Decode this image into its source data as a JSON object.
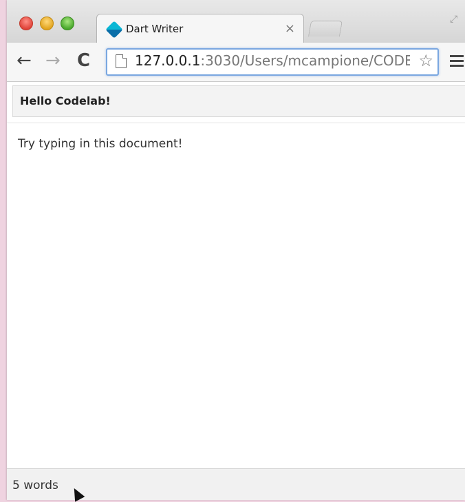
{
  "browser": {
    "tab": {
      "title": "Dart Writer",
      "close_glyph": "×"
    },
    "address_bar": {
      "url_host": "127.0.0.1",
      "url_rest": ":3030/Users/mcampione/CODE"
    },
    "icons": {
      "back": "←",
      "forward": "→",
      "reload": "C",
      "star": "☆",
      "fullscreen": "⤢"
    },
    "accent_color": "#7aa7e0"
  },
  "app": {
    "header_title": "Hello Codelab!",
    "editor_text": "Try typing in this document!",
    "status_word_count": "5 words"
  }
}
